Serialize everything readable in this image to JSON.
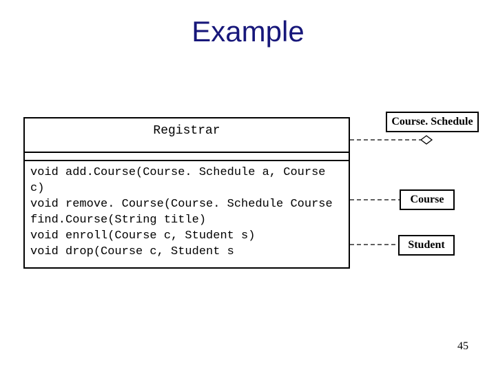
{
  "title": "Example",
  "page_number": "45",
  "registrar": {
    "name": "Registrar",
    "operations": "void add.Course(Course. Schedule a, Course c)\nvoid remove. Course(Course. Schedule Course\nfind.Course(String title)\nvoid enroll(Course c, Student s)\nvoid drop(Course c, Student s"
  },
  "boxes": {
    "course_schedule": "Course. Schedule",
    "course": "Course",
    "student": "Student"
  }
}
